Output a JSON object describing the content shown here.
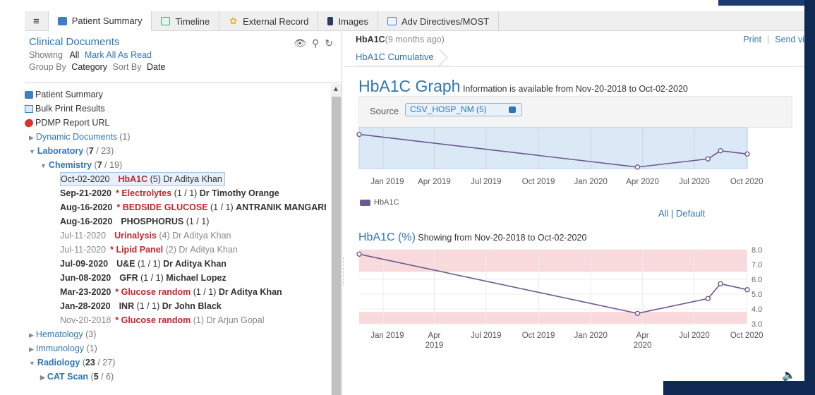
{
  "tabs": [
    {
      "label": "Patient Summary",
      "icon": "patient-summary-icon",
      "color": "#3d7fc4",
      "active": true
    },
    {
      "label": "Timeline",
      "icon": "timeline-icon",
      "color": "#4aa07a"
    },
    {
      "label": "External Record",
      "icon": "external-record-icon",
      "color": "#e6b422"
    },
    {
      "label": "Images",
      "icon": "images-icon",
      "color": "#2a3b5e"
    },
    {
      "label": "Adv Directives/MOST",
      "icon": "adv-directives-icon",
      "color": "#3d7fc4"
    }
  ],
  "left": {
    "title": "Clinical Documents",
    "showing_label": "Showing",
    "showing_value": "All",
    "mark_all": "Mark All As Read",
    "group_label": "Group By",
    "group_value": "Category",
    "sort_label": "Sort By",
    "sort_value": "Date"
  },
  "tree": {
    "patient_summary": "Patient Summary",
    "bulk_print": "Bulk Print Results",
    "pdmp": "PDMP Report URL",
    "dynamic": {
      "label": "Dynamic Documents",
      "count": "(1)"
    },
    "laboratory": {
      "label": "Laboratory",
      "count_open": " (",
      "count_bold": "7",
      "count_rest": " / 23)"
    },
    "chemistry": {
      "label": "Chemistry",
      "count_open": " (",
      "count_bold": "7",
      "count_rest": " / 19)"
    },
    "docs": [
      {
        "date": "Oct-02-2020",
        "star": "",
        "name": "HbA1C",
        "count": " (5) ",
        "author": "Dr Aditya Khan",
        "state": "selected"
      },
      {
        "date": "Sep-21-2020",
        "star": "* ",
        "name": "Electrolytes",
        "count": " (1 / 1) ",
        "author": "Dr Timothy Orange",
        "state": "unread"
      },
      {
        "date": "Aug-16-2020",
        "star": "* ",
        "name": "BEDSIDE GLUCOSE",
        "count": " (1 / 1) ",
        "author": "ANTRANIK MANGARI",
        "state": "unread"
      },
      {
        "date": "Aug-16-2020",
        "star": "",
        "name": "PHOSPHORUS",
        "count": " (1 / 1)",
        "author": "",
        "state": "unread-plain"
      },
      {
        "date": "Jul-11-2020",
        "star": "",
        "name": "Urinalysis",
        "count": " (4) ",
        "author": "Dr Aditya Khan",
        "state": "read"
      },
      {
        "date": "Jul-11-2020",
        "star": "* ",
        "name": "Lipid Panel",
        "count": " (2) ",
        "author": "Dr Aditya Khan",
        "state": "read"
      },
      {
        "date": "Jul-09-2020",
        "star": "",
        "name": "U&E",
        "count": " (1 / 1) ",
        "author": "Dr Aditya Khan",
        "state": "unread-plain"
      },
      {
        "date": "Jun-08-2020",
        "star": "",
        "name": "GFR",
        "count": " (1 / 1) ",
        "author": "Michael Lopez",
        "state": "unread-plain"
      },
      {
        "date": "Mar-23-2020",
        "star": "* ",
        "name": "Glucose random",
        "count": " (1 / 1) ",
        "author": "Dr Aditya Khan",
        "state": "unread"
      },
      {
        "date": "Jan-28-2020",
        "star": "",
        "name": "INR",
        "count": " (1 / 1) ",
        "author": "Dr John Black",
        "state": "unread-plain"
      },
      {
        "date": "Nov-20-2018",
        "star": "* ",
        "name": "Glucose random",
        "count": " (1) ",
        "author": "Dr Arjun Gopal",
        "state": "read"
      }
    ],
    "hematology": {
      "label": "Hematology",
      "count": " (3)"
    },
    "immunology": {
      "label": "Immunology",
      "count": " (1)"
    },
    "radiology": {
      "label": "Radiology",
      "count_open": " (",
      "count_bold": "23",
      "count_rest": " / 27)"
    },
    "catscan": {
      "label": "CAT Scan",
      "count_open": " (",
      "count_bold": "5",
      "count_rest": " / 6)"
    }
  },
  "right": {
    "doc_name": "HbA1C",
    "doc_age": " (9 months ago)",
    "print": "Print",
    "send": "Send vi",
    "crumb": "HbA1C Cumulative",
    "graph_title": "HbA1C Graph",
    "graph_sub": " Information is available from Nov-20-2018 to Oct-02-2020",
    "source_label": "Source",
    "source_value": "CSV_HOSP_NM (5)",
    "legend": "HbA1C",
    "all_default": "All | Default",
    "pct_title": "HbA1C (%)",
    "pct_sub": " Showing from Nov-20-2018 to Oct-02-2020"
  },
  "chart_data": [
    {
      "type": "line",
      "title": "HbA1C Graph",
      "series": [
        {
          "name": "HbA1C",
          "x": [
            "2018-11-20",
            "2020-03-23",
            "2020-07-25",
            "2020-08-16",
            "2020-10-02"
          ],
          "y": [
            7.7,
            3.7,
            4.7,
            5.7,
            5.3
          ]
        }
      ],
      "xticks": [
        "Jan 2019",
        "Apr 2019",
        "Jul 2019",
        "Oct 2019",
        "Jan 2020",
        "Apr 2020",
        "Jul 2020",
        "Oct 2020"
      ],
      "color": "#6b5a8e"
    },
    {
      "type": "line",
      "title": "HbA1C (%)",
      "series": [
        {
          "x": [
            "2018-11-20",
            "2020-03-23",
            "2020-07-25",
            "2020-08-16",
            "2020-10-02"
          ],
          "y": [
            7.7,
            3.7,
            4.7,
            5.7,
            5.3
          ]
        }
      ],
      "xticks": [
        [
          "Jan 2019",
          ""
        ],
        [
          "Apr",
          "2019"
        ],
        [
          "Jul 2019",
          ""
        ],
        [
          "Oct 2019",
          ""
        ],
        [
          "Jan 2020",
          ""
        ],
        [
          "Apr",
          "2020"
        ],
        [
          "Jul 2020",
          ""
        ],
        [
          "Oct 2020",
          ""
        ]
      ],
      "yticks": [
        "8.0",
        "7.0",
        "6.0",
        "5.0",
        "4.0",
        "3.0"
      ],
      "ylim": [
        3.0,
        8.0
      ],
      "abnormal_bands": [
        [
          6.5,
          8.0
        ],
        [
          3.0,
          3.8
        ]
      ],
      "band_color": "#f9d9dc",
      "color": "#6b5a8e"
    }
  ]
}
